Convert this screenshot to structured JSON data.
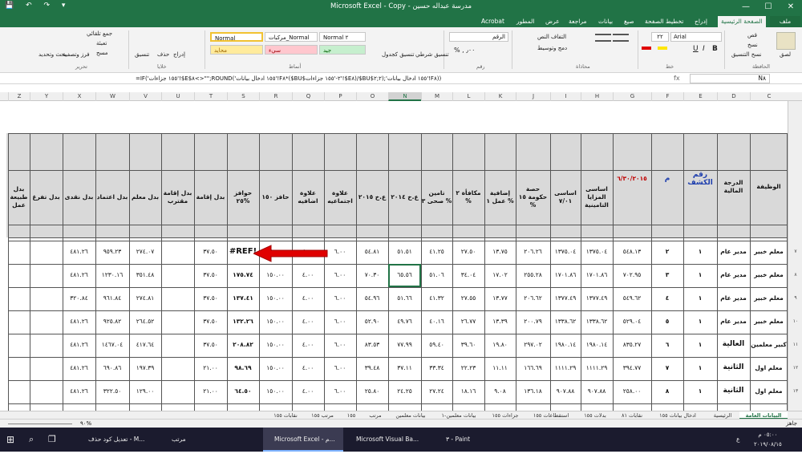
{
  "window": {
    "title": "Microsoft Excel - Copy - مدرسة عبداله حسين",
    "controls": [
      "—",
      "☐",
      "✕"
    ]
  },
  "tabs": [
    "ملف",
    "الصفحة الرئيسية",
    "إدراج",
    "تخطيط الصفحة",
    "صيغ",
    "بيانات",
    "مراجعة",
    "عرض",
    "المطور",
    "Acrobat"
  ],
  "ribbon": {
    "paste": "لصق",
    "cut": "قص",
    "copy": "نسخ",
    "format_painter": "نسخ التنسيق",
    "font_name": "Arial",
    "font_size": "٢٢",
    "bold": "B",
    "italic": "I",
    "underline": "U",
    "wrap_text": "التفاف النص",
    "merge_center": "دمج وتوسيط",
    "number_format": "الرقم",
    "conditional_format": "تنسيق شرطي",
    "format_table": "تنسيق كجدول",
    "style_normal2": "Normal ٢",
    "style_marks": "مركبات_Normal",
    "style_normal": "Normal",
    "style_good": "جيد",
    "style_bad": "سيء",
    "style_neutral": "محايد",
    "insert": "إدراج",
    "delete": "حذف",
    "format": "تنسيق",
    "autosum": "جمع تلقائي",
    "fill": "تعبئة",
    "clear": "مسح",
    "sort_filter": "فرز وتصفية",
    "find_select": "بحث وتحديد",
    "groups": {
      "clipboard": "الحافظة",
      "font": "خط",
      "alignment": "محاذاة",
      "number": "رقم",
      "styles": "أنماط",
      "cells": "خلايا",
      "editing": "تحرير"
    }
  },
  "formula_bar": {
    "name_box": "N٨",
    "formula": "=IF('١٥٥ جزاءات'!$E$٨<>\"\";ROUND('١٥٥ ادخال بيانات'!F٨*($BU$٢-'١٥٥ جزاءات'!$E٨)/$BU$٢;٢);'١٥٥ ادخال بيانات'!F٨))"
  },
  "columns": [
    "C",
    "D",
    "E",
    "F",
    "G",
    "H",
    "I",
    "J",
    "K",
    "L",
    "M",
    "N",
    "O",
    "P",
    "Q",
    "R",
    "S",
    "T",
    "U",
    "V",
    "W",
    "X",
    "Y",
    "Z"
  ],
  "row_numbers": [
    "٧",
    "٨",
    "٩",
    "١٠",
    "١١",
    "١٢",
    "١٣"
  ],
  "headers": {
    "C": "الوظيفة",
    "D": "الدرجة المالية",
    "E": "رقم الكشف",
    "F": "م",
    "G": "٦/٣٠/٢٠١٥",
    "H": "اساسى المزايا التامينية",
    "I": "اساسى ٧/٠١",
    "J": "حصة حكومة ١٥ %",
    "K": "إضافية عمل ١ %",
    "L": "مكافأة ٢ %",
    "M": "تامين صحى ٣ %",
    "N": "ع.خ ٢٠١٤",
    "O": "ع.خ ٢٠١٥",
    "P": "علاوة اجتماعيه",
    "Q": "علاوة اضافيه",
    "R": "حافز ١٥٠",
    "S": "حوافز ٢٥%",
    "T": "بدل إقامة",
    "U": "بدل إقامة مقترب",
    "V": "بدل معلم",
    "W": "بدل اعتماد",
    "X": "بدل نقدى",
    "Y": "بدل تفرغ",
    "Z": "بدل طبيعة عمل"
  },
  "rows": [
    {
      "C": "معلم خبير",
      "D": "مدير عام",
      "E": "١",
      "F": "٢",
      "G": "٥٤٨.١٣",
      "H": "١٣٧٥.٠٤",
      "I": "١٣٧٥.٠٤",
      "J": "٢٠٦.٢٦",
      "K": "١٣.٧٥",
      "L": "٢٧.٥٠",
      "M": "٤١.٢٥",
      "N": "٥١.٥١",
      "O": "٥٤.٨١",
      "P": "٦.٠٠",
      "Q": "٤.٠٠",
      "R": "١٥٠.٠٠",
      "S": "#REF!",
      "T": "٣٧.٥٠",
      "U": "",
      "V": "٢٧٤.٠٧",
      "W": "٩٥٩.٢٣",
      "X": "٤٨١.٢٦",
      "Y": "",
      "Z": ""
    },
    {
      "C": "معلم خبير",
      "D": "مدير عام",
      "E": "١",
      "F": "٣",
      "G": "٧٠٢.٩٥",
      "H": "١٧٠١.٨٦",
      "I": "١٧٠١.٨٦",
      "J": "٢٥٥.٢٨",
      "K": "١٧.٠٢",
      "L": "٣٤.٠٤",
      "M": "٥١.٠٦",
      "N": "٦٥.٥٦",
      "O": "٧٠.٣٠",
      "P": "٦.٠٠",
      "Q": "٤.٠٠",
      "R": "١٥٠.٠٠",
      "S": "١٧٥.٧٤",
      "T": "٣٧.٥٠",
      "U": "",
      "V": "٣٥١.٤٨",
      "W": "١٢٣٠.١٦",
      "X": "٤٨١.٢٦",
      "Y": "",
      "Z": ""
    },
    {
      "C": "معلم خبير",
      "D": "مدير عام",
      "E": "١",
      "F": "٤",
      "G": "٥٤٩.٦٢",
      "H": "١٣٧٧.٤٩",
      "I": "١٣٧٧.٤٩",
      "J": "٢٠٦.٦٢",
      "K": "١٣.٧٧",
      "L": "٢٧.٥٥",
      "M": "٤١.٣٢",
      "N": "٥١.٦٦",
      "O": "٥٤.٩٦",
      "P": "٦.٠٠",
      "Q": "٤.٠٠",
      "R": "١٥٠.٠٠",
      "S": "١٣٧.٤١",
      "T": "٣٧.٥٠",
      "U": "",
      "V": "٢٧٤.٨١",
      "W": "٩٦١.٨٤",
      "X": "٣٢٠.٨٤",
      "Y": "",
      "Z": ""
    },
    {
      "C": "معلم خبير",
      "D": "مدير عام",
      "E": "١",
      "F": "٥",
      "G": "٥٢٩.٠٤",
      "H": "١٣٣٨.٦٢",
      "I": "١٣٣٨.٦٢",
      "J": "٢٠٠.٧٩",
      "K": "١٣.٣٩",
      "L": "٢٦.٧٧",
      "M": "٤٠.١٦",
      "N": "٤٩.٧٦",
      "O": "٥٢.٩٠",
      "P": "٦.٠٠",
      "Q": "٤.٠٠",
      "R": "١٥٠.٠٠",
      "S": "١٣٢.٢٦",
      "T": "٣٧.٥٠",
      "U": "",
      "V": "٢٦٤.٥٢",
      "W": "٩٢٥.٨٢",
      "X": "٤٨١.٢٦",
      "Y": "",
      "Z": ""
    },
    {
      "C": "كبير معلمين",
      "D": "العالية",
      "E": "١",
      "F": "٦",
      "G": "٨٣٥.٢٧",
      "H": "١٩٨٠.١٤",
      "I": "١٩٨٠.١٤",
      "J": "٢٩٧.٠٢",
      "K": "١٩.٨٠",
      "L": "٣٩.٦٠",
      "M": "٥٩.٤٠",
      "N": "٧٧.٩٩",
      "O": "٨٣.٥٣",
      "P": "٦.٠٠",
      "Q": "٤.٠٠",
      "R": "١٥٠.٠٠",
      "S": "٢٠٨.٨٢",
      "T": "٣٧.٥٠",
      "U": "",
      "V": "٤١٧.٦٤",
      "W": "١٤٦٧.٠٤",
      "X": "٤٨١.٢٦",
      "Y": "",
      "Z": ""
    },
    {
      "C": "معلم اول",
      "D": "الثانية",
      "E": "١",
      "F": "٧",
      "G": "٣٩٤.٧٧",
      "H": "١١١١.٢٩",
      "I": "١١١١.٢٩",
      "J": "١٦٦.٦٩",
      "K": "١١.١١",
      "L": "٢٢.٢٣",
      "M": "٣٣.٣٤",
      "N": "٣٧.١١",
      "O": "٣٩.٤٨",
      "P": "٦.٠٠",
      "Q": "٤.٠٠",
      "R": "١٥٠.٠٠",
      "S": "٩٨.٦٩",
      "T": "٢١.٠٠",
      "U": "",
      "V": "١٩٧.٣٩",
      "W": "٦٩٠.٨٦",
      "X": "٤٨١.٢٦",
      "Y": "",
      "Z": ""
    },
    {
      "C": "معلم اول",
      "D": "الثانية",
      "E": "١",
      "F": "٨",
      "G": "٢٥٨.٠٠",
      "H": "٩٠٧.٨٨",
      "I": "٩٠٧.٨٨",
      "J": "١٣٦.١٨",
      "K": "٩.٠٨",
      "L": "١٨.١٦",
      "M": "٢٧.٢٤",
      "N": "٢٤.٢٥",
      "O": "٢٥.٨٠",
      "P": "٦.٠٠",
      "Q": "٤.٠٠",
      "R": "١٥٠.٠٠",
      "S": "٦٤.٥٠",
      "T": "٢١.٠٠",
      "U": "",
      "V": "١٢٩.٠٠",
      "W": "٣٢٢.٥٠",
      "X": "٤٨١.٢٦",
      "Y": "",
      "Z": ""
    }
  ],
  "sheet_tabs": [
    "البيانات العامة",
    "الرئيسية",
    "ادخال بيانات ١٥٥",
    "نقابات ٨١",
    "بدلات ١٥٥",
    "استقطاعات ١٥٥",
    "جزاءات ١٥٥",
    "بيانات معلمين-١",
    "بيانات معلمين",
    "مرتب",
    "١٥٥",
    "مرتب ١٥٥",
    "نقابات ١٥٥"
  ],
  "status": {
    "ready": "جاهز",
    "zoom": "٩٠%"
  },
  "taskbar": {
    "items": [
      "تعديل كود حذف - M...",
      "مرتب",
      "Microsoft Excel - م...",
      "Microsoft Visual Ba...",
      "٣ - Paint"
    ],
    "time": "٠٥:٠٠ م",
    "date": "٢٠١٩/٠٨/١٥",
    "lang": "ع"
  }
}
